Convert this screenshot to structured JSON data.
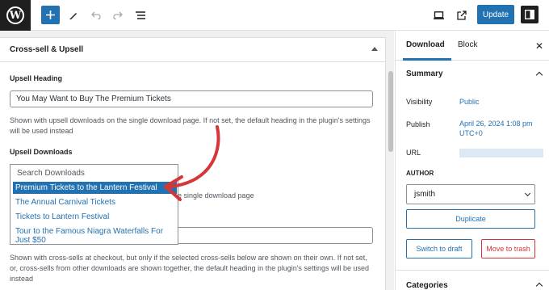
{
  "toolbar": {
    "update_label": "Update",
    "icons": [
      "wordpress-logo",
      "plus-icon",
      "pen-icon",
      "undo-icon",
      "redo-icon",
      "list-view-icon",
      "desktop-preview-icon",
      "external-link-icon",
      "sidebar-toggle-icon"
    ],
    "accent": "#2271b1"
  },
  "meta_box": {
    "title": "Cross-sell & Upsell",
    "upsell_heading_label": "Upsell Heading",
    "upsell_heading_value": "You May Want to Buy The Premium Tickets",
    "upsell_heading_desc": "Shown with upsell downloads on the single download page. If not set, the default heading in the plugin's settings will be used instead",
    "upsell_downloads_label": "Upsell Downloads",
    "dropdown": {
      "search_placeholder": "Search Downloads",
      "items": [
        "Premium Tickets to the Lantern Festival",
        "The Annual Carnival Tickets",
        "Tickets to Lantern Festival",
        "Tour to the Famous Niagra Waterfalls For Just $50"
      ]
    },
    "hidden_desc_tail": "e single download page",
    "crosssell_desc": "Shown with cross-sells at checkout, but only if the selected cross-sells below are shown on their own. If not set, or, cross-sells from other downloads are shown together, the default heading in the plugin's settings will be used instead"
  },
  "sidebar": {
    "tabs": [
      "Download",
      "Block"
    ],
    "summary_title": "Summary",
    "visibility_label": "Visibility",
    "visibility_value": "Public",
    "publish_label": "Publish",
    "publish_value": "April 26, 2024 1:08 pm UTC+0",
    "url_label": "URL",
    "author_label": "AUTHOR",
    "author_value": "jsmith",
    "duplicate_label": "Duplicate",
    "switch_draft_label": "Switch to draft",
    "move_trash_label": "Move to trash",
    "categories_title": "Categories"
  },
  "colors": {
    "annotation_arrow": "#d63638",
    "danger": "#d63638"
  }
}
